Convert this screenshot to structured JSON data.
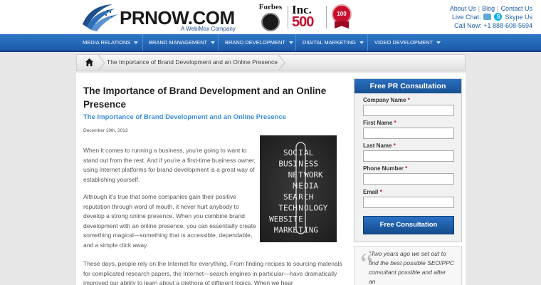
{
  "header": {
    "logo_text": "PRNOW.COM",
    "logo_tagline": "A WebiMax Company",
    "forbes_text": "Forbes",
    "inc_title": "Inc.",
    "inc_number": "500",
    "seal_text": "100",
    "top_links": [
      "About Us",
      "Blog",
      "Contact Us"
    ],
    "live_chat": "Live Chat:",
    "skype": "Skype Us",
    "phone": "Call Now: +1 888-608-5694"
  },
  "nav": {
    "items": [
      "MEDIA RELATIONS",
      "BRAND MANAGEMENT",
      "BRAND DEVELOPMENT",
      "DIGITAL MARKETING",
      "VIDEO DEVELOPMENT"
    ]
  },
  "breadcrumb": {
    "current": "The Importance of Brand Development and an Online Presence"
  },
  "article": {
    "title": "The Importance of Brand Development and an Online Presence",
    "subtitle": "The Importance of Brand Development and an Online Presence",
    "date": "December 19th, 2013",
    "p1": "When it comes to running a business, you’re going to want to stand out from the rest. And if you’re a first-time business owner, using Internet platforms for brand development is a great way of establishing yourself.",
    "p2": "Although it’s true that some companies gain their positive reputation through word of mouth, it never hurt anybody to develop a strong online presence. When you combine brand development with an online presence, you can essentially create something magical—something that is accessible, dependable, and a simple click away.",
    "p3": "These days, people rely on the Internet for everything. From finding recipes to sourcing materials for complicated research papers, the Internet—search engines in particular—have dramatically improved our ability to learn about a plethora of different topics. When we hear"
  },
  "chalkboard": {
    "rows": [
      [
        "SOC",
        "I",
        "AL"
      ],
      [
        "BUSI",
        "N",
        "ESS"
      ],
      [
        "NE",
        "T",
        "WORK"
      ],
      [
        "M",
        "E",
        "DIA"
      ],
      [
        "SEA",
        "R",
        "CH"
      ],
      [
        "TECH",
        "N",
        "OLOGY"
      ],
      [
        "WEBSIT",
        "E",
        ""
      ],
      [
        "MARKE",
        "T",
        "ING"
      ]
    ]
  },
  "form": {
    "heading": "Free PR Consultation",
    "fields": [
      {
        "label": "Company Name",
        "required": "*"
      },
      {
        "label": "First Name",
        "required": "*"
      },
      {
        "label": "Last Name",
        "required": "*"
      },
      {
        "label": "Phone Number",
        "required": "*"
      },
      {
        "label": "Email",
        "required": "*"
      }
    ],
    "submit": "Free Consultation"
  },
  "testimonial": {
    "quote_mark": "“",
    "text": "\"Two years ago we set out to find the best possible SEO/PPC consultant possible and after an"
  },
  "colors": {
    "nav_blue": "#1c5aa8",
    "link_blue": "#1e5fa8",
    "subtitle_blue": "#3b8fd9",
    "required_red": "#c8102e"
  }
}
